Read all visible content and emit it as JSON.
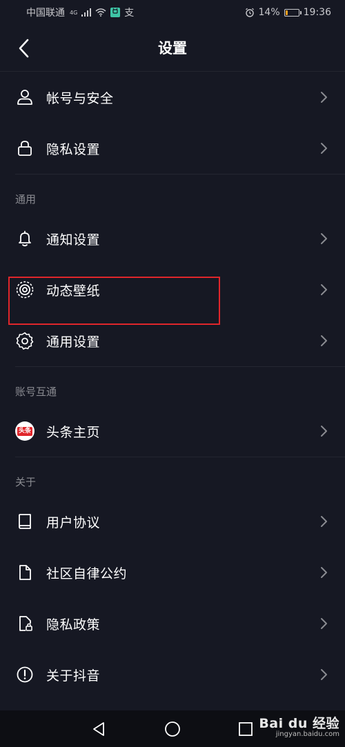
{
  "status_bar": {
    "carrier": "中国联通",
    "network": "4G",
    "extra_glyph": "支",
    "battery_percent": "14%",
    "battery_level": 0.14,
    "time": "19:36"
  },
  "header": {
    "title": "设置"
  },
  "account_section": {
    "items": [
      {
        "label": "帐号与安全",
        "icon": "user-icon"
      },
      {
        "label": "隐私设置",
        "icon": "lock-icon"
      }
    ]
  },
  "general_section": {
    "title": "通用",
    "items": [
      {
        "label": "通知设置",
        "icon": "bell-icon"
      },
      {
        "label": "动态壁纸",
        "icon": "wallpaper-icon"
      },
      {
        "label": "通用设置",
        "icon": "gear-icon"
      }
    ]
  },
  "link_section": {
    "title": "账号互通",
    "items": [
      {
        "label": "头条主页",
        "icon": "toutiao-logo",
        "logo_text": "头条"
      }
    ]
  },
  "about_section": {
    "title": "关于",
    "items": [
      {
        "label": "用户协议",
        "icon": "book-icon"
      },
      {
        "label": "社区自律公约",
        "icon": "document-icon"
      },
      {
        "label": "隐私政策",
        "icon": "privacy-policy-icon"
      },
      {
        "label": "关于抖音",
        "icon": "info-icon"
      }
    ]
  },
  "watermark": {
    "logo": "Bai du 经验",
    "url": "jingyan.baidu.com"
  },
  "colors": {
    "background": "#161823",
    "text": "#ffffff",
    "section_title": "#8a8b91",
    "highlight": "#e0262b",
    "chevron": "#8a8b91"
  }
}
